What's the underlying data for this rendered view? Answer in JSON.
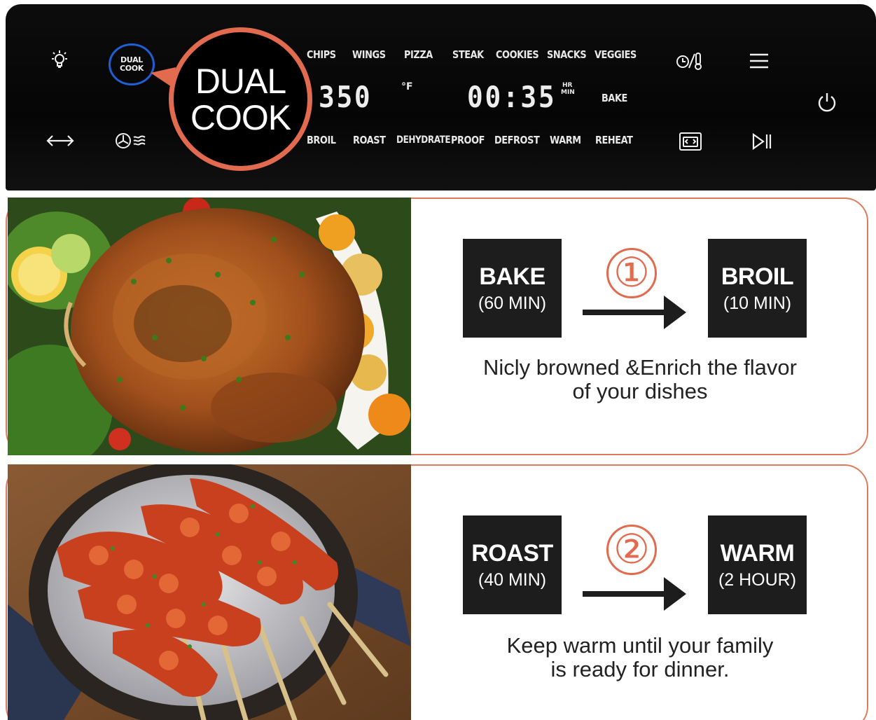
{
  "panel": {
    "dual_cook_small_line1": "DUAL",
    "dual_cook_small_line2": "COOK",
    "callout_line1": "DUAL",
    "callout_line2": "COOK",
    "functions_top": [
      "CHIPS",
      "WINGS",
      "PIZZA",
      "STEAK",
      "COOKIES",
      "SNACKS",
      "VEGGIES"
    ],
    "functions_bottom": [
      "BROIL",
      "ROAST",
      "DEHYDRATE",
      "PROOF",
      "DEFROST",
      "WARM",
      "REHEAT"
    ],
    "temperature": "350",
    "temperature_unit": "°F",
    "time": "00:35",
    "time_unit_hr": "HR",
    "time_unit_min": "MIN",
    "mode": "BAKE",
    "icons": [
      "light-icon",
      "rotate-arrows-icon",
      "fan-icon",
      "temp-time-icon",
      "menu-icon",
      "oven-icon",
      "play-pause-icon",
      "power-icon"
    ]
  },
  "sections": [
    {
      "photo": "roast-chicken",
      "step_number": "①",
      "first": {
        "mode": "BAKE",
        "duration": "(60 MIN)"
      },
      "second": {
        "mode": "BROIL",
        "duration": "(10 MIN)"
      },
      "caption_line1": "Nicly browned &Enrich the flavor",
      "caption_line2": "of your dishes"
    },
    {
      "photo": "chicken-skewers",
      "step_number": "②",
      "first": {
        "mode": "ROAST",
        "duration": "(40 MIN)"
      },
      "second": {
        "mode": "WARM",
        "duration": "(2 HOUR)"
      },
      "caption_line1": "Keep warm until your family",
      "caption_line2": "is ready for dinner."
    }
  ],
  "colors": {
    "accent": "#e26a4e",
    "panel": "#0a0a0a",
    "blue_ring": "#1f5fd6",
    "step_box": "#1d1d1d"
  }
}
